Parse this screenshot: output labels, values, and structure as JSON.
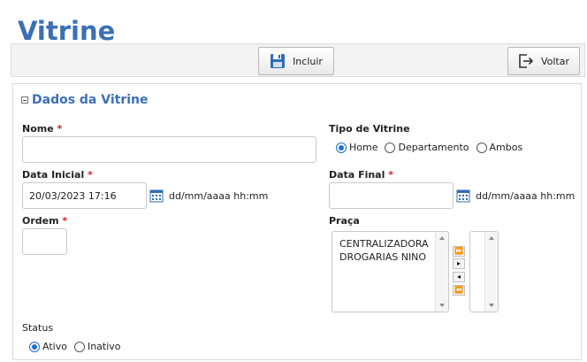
{
  "page": {
    "title": "Vitrine"
  },
  "toolbar": {
    "incluir_label": "Incluir",
    "voltar_label": "Voltar"
  },
  "panel": {
    "title": "Dados da Vitrine"
  },
  "form": {
    "nome": {
      "label": "Nome",
      "required_mark": "*",
      "value": ""
    },
    "tipo": {
      "label": "Tipo de Vitrine",
      "options": [
        "Home",
        "Departamento",
        "Ambos"
      ],
      "selected": "Home"
    },
    "data_inicial": {
      "label": "Data Inicial",
      "required_mark": "*",
      "value": "20/03/2023 17:16",
      "format": "dd/mm/aaaa hh:mm"
    },
    "data_final": {
      "label": "Data Final",
      "required_mark": "*",
      "value": "",
      "format": "dd/mm/aaaa hh:mm"
    },
    "ordem": {
      "label": "Ordem",
      "required_mark": "*",
      "value": ""
    },
    "praca": {
      "label": "Praça",
      "available": [
        "CENTRALIZADORA",
        "DROGARIAS NINO"
      ],
      "selected": [],
      "move_buttons": [
        "⏩",
        "▸",
        "◂",
        "⏪"
      ]
    },
    "status": {
      "label": "Status",
      "options": [
        "Ativo",
        "Inativo"
      ],
      "selected": "Ativo"
    }
  },
  "colors": {
    "title_blue": "#3c6fb5",
    "required_red": "#cc2222",
    "radio_blue": "#1f6fd1"
  }
}
